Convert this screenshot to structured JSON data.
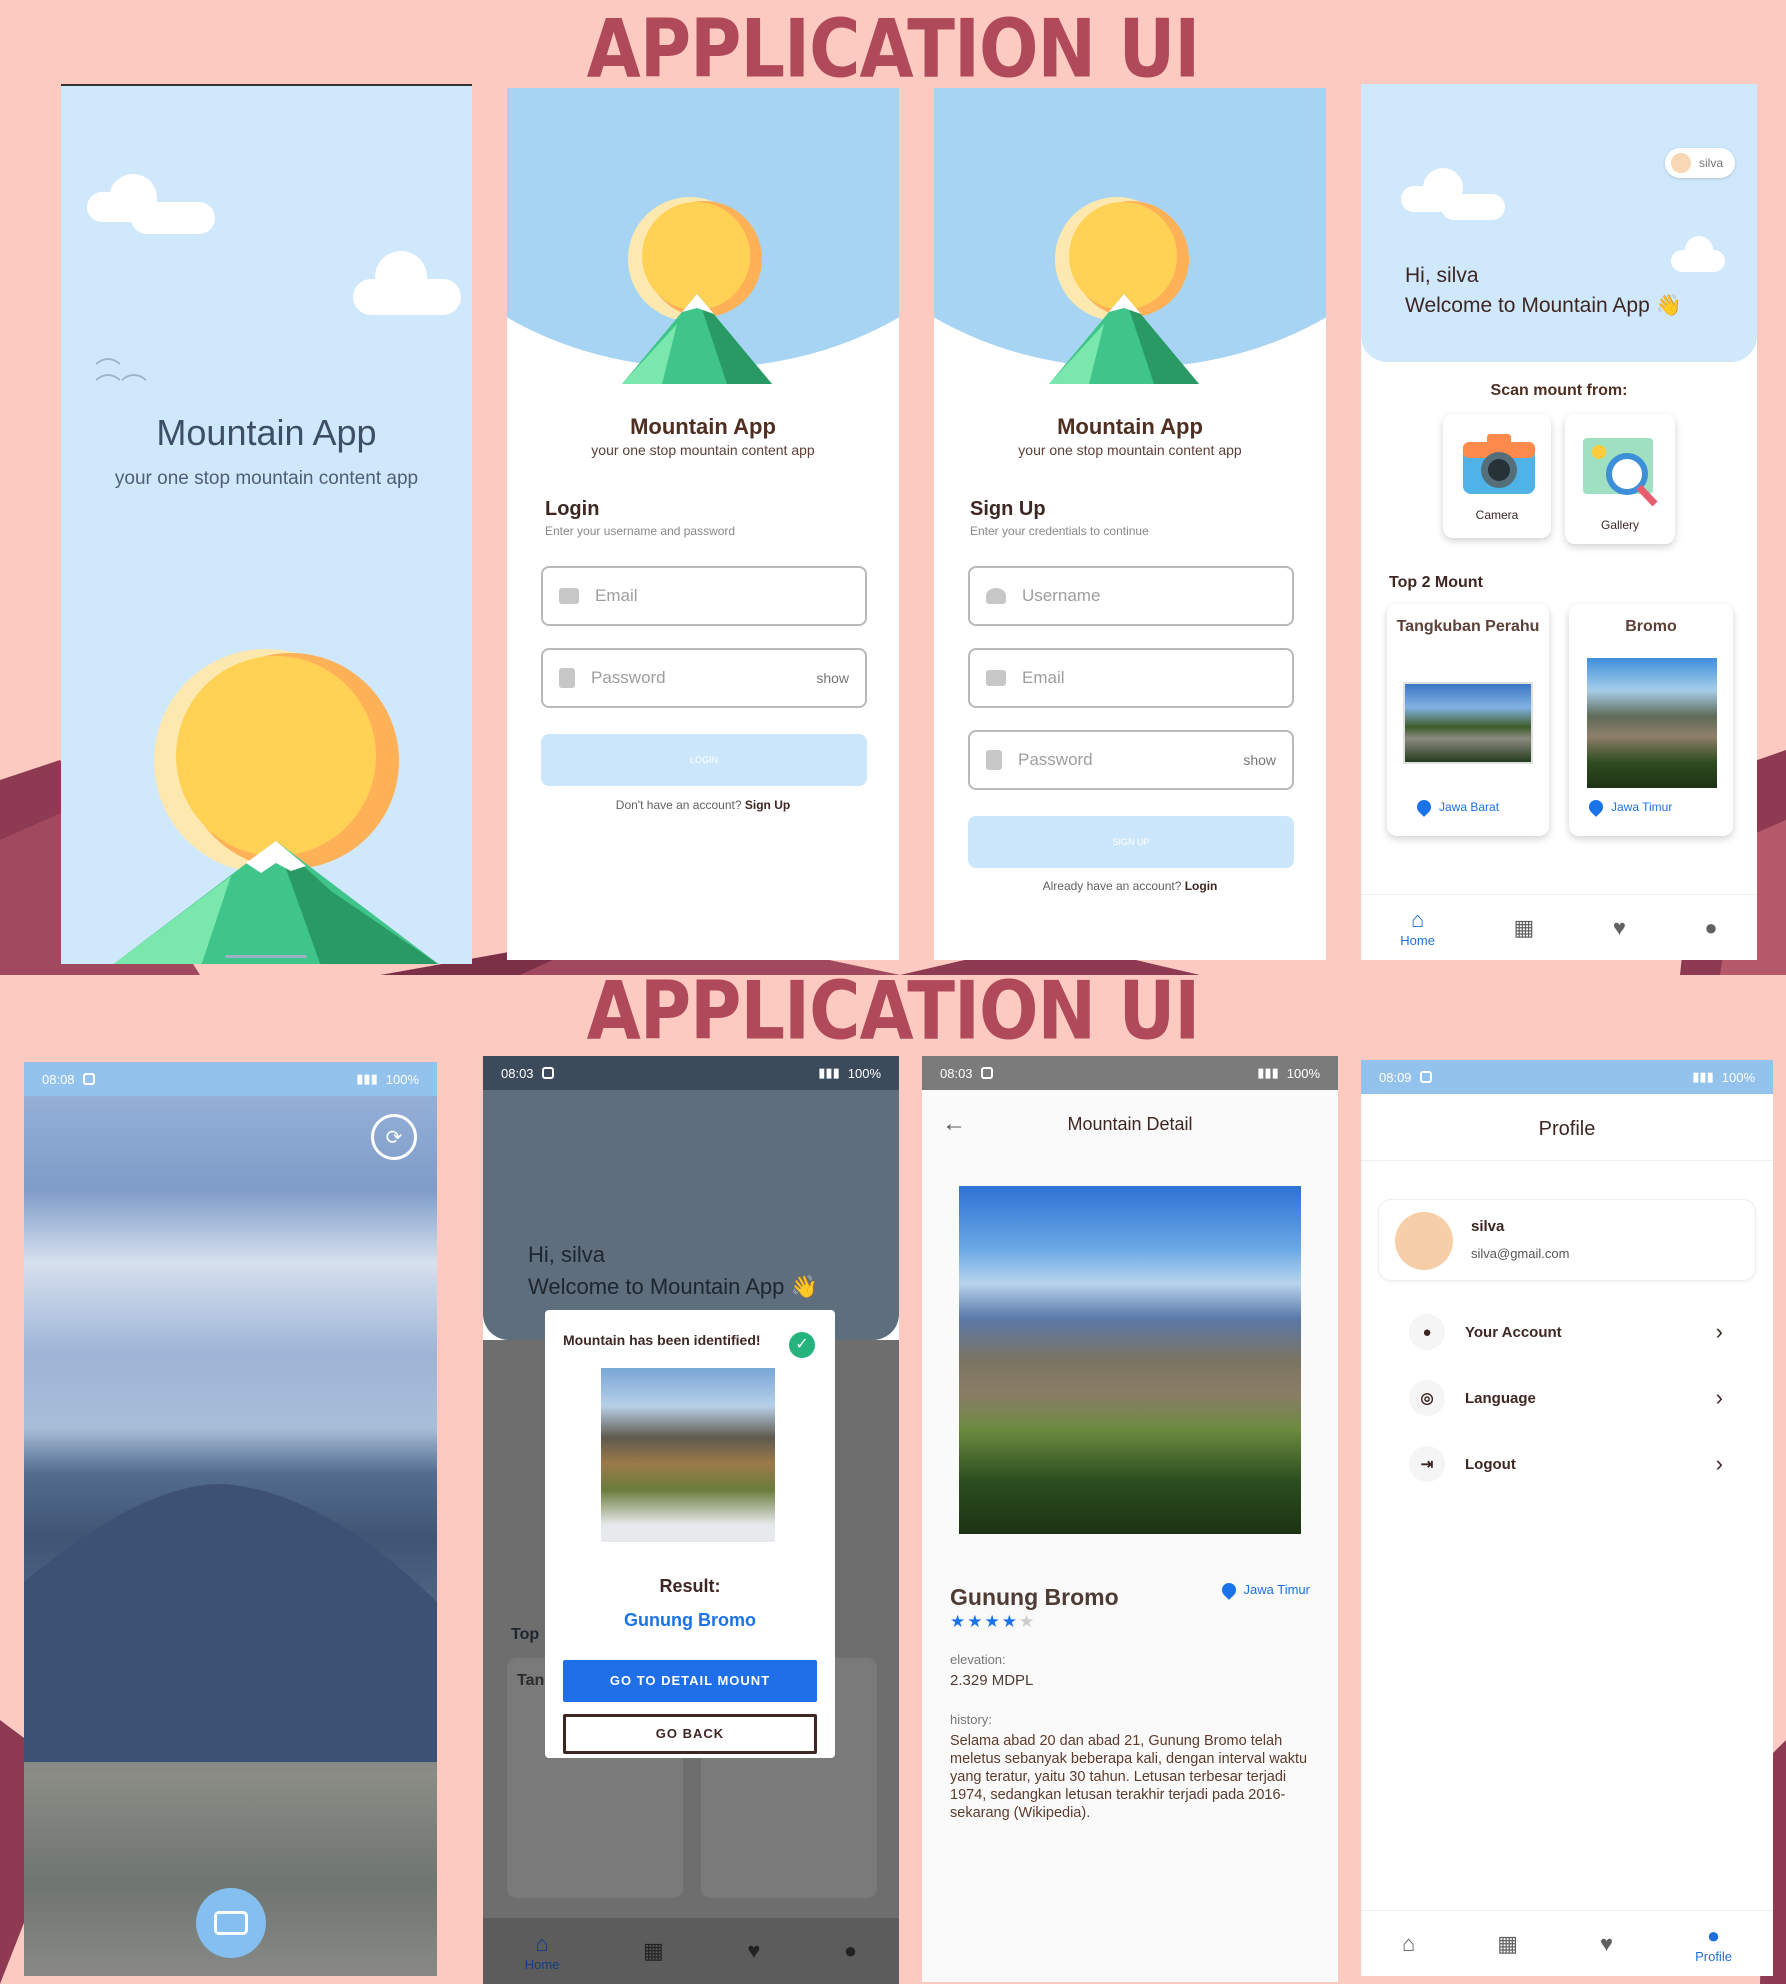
{
  "banner": {
    "top": "APPLICATION UI",
    "bottom": "APPLICATION UI"
  },
  "colors": {
    "background": "#fccac1",
    "banner": "#b04a5a",
    "sky": "#cfe8fb",
    "accent": "#1a73e8",
    "title": "#4e2f22"
  },
  "status": {
    "time_a": "08:09",
    "time_b": "08:03",
    "time_c": "08:08",
    "battery": "100%"
  },
  "splash": {
    "title": "Mountain App",
    "subtitle": "your one stop mountain content app"
  },
  "login": {
    "app_title": "Mountain App",
    "app_subtitle": "your one stop mountain content app",
    "heading": "Login",
    "hint": "Enter your username and password",
    "email_placeholder": "Email",
    "password_placeholder": "Password",
    "show": "show",
    "button": "LOGIN",
    "footer_text": "Don't have an account?",
    "footer_link": "Sign Up"
  },
  "signup": {
    "app_title": "Mountain App",
    "app_subtitle": "your one stop mountain content app",
    "heading": "Sign Up",
    "hint": "Enter your credentials to continue",
    "username_placeholder": "Username",
    "email_placeholder": "Email",
    "password_placeholder": "Password",
    "show": "show",
    "button": "SIGN UP",
    "footer_text": "Already have an account?",
    "footer_link": "Login"
  },
  "home": {
    "user_chip": "silva",
    "greeting": "Hi, silva",
    "welcome": "Welcome to Mountain App 👋",
    "scan_title": "Scan mount from:",
    "camera": "Camera",
    "gallery": "Gallery",
    "top_title": "Top 2 Mount",
    "mount1": {
      "name": "Tangkuban Perahu",
      "region": "Jawa Barat"
    },
    "mount2": {
      "name": "Bromo",
      "region": "Jawa Timur"
    },
    "nav_home": "Home",
    "nav_profile": "Profile"
  },
  "dialog": {
    "identified": "Mountain has been identified!",
    "result_label": "Result:",
    "result": "Gunung Bromo",
    "detail_button": "GO TO DETAIL MOUNT",
    "back_button": "GO BACK",
    "bg_top": "Top",
    "bg_card": "Tan"
  },
  "detail": {
    "title": "Mountain Detail",
    "name": "Gunung Bromo",
    "region": "Jawa Timur",
    "rating": 4,
    "elevation_label": "elevation:",
    "elevation": "2.329 MDPL",
    "history_label": "history:",
    "history": "Selama abad 20 dan abad 21, Gunung Bromo telah meletus sebanyak beberapa kali, dengan interval waktu yang teratur, yaitu 30 tahun. Letusan terbesar terjadi 1974, sedangkan letusan terakhir terjadi pada 2016-sekarang (Wikipedia)."
  },
  "profile": {
    "title": "Profile",
    "name": "silva",
    "email": "silva@gmail.com",
    "items": [
      "Your Account",
      "Language",
      "Logout"
    ]
  }
}
